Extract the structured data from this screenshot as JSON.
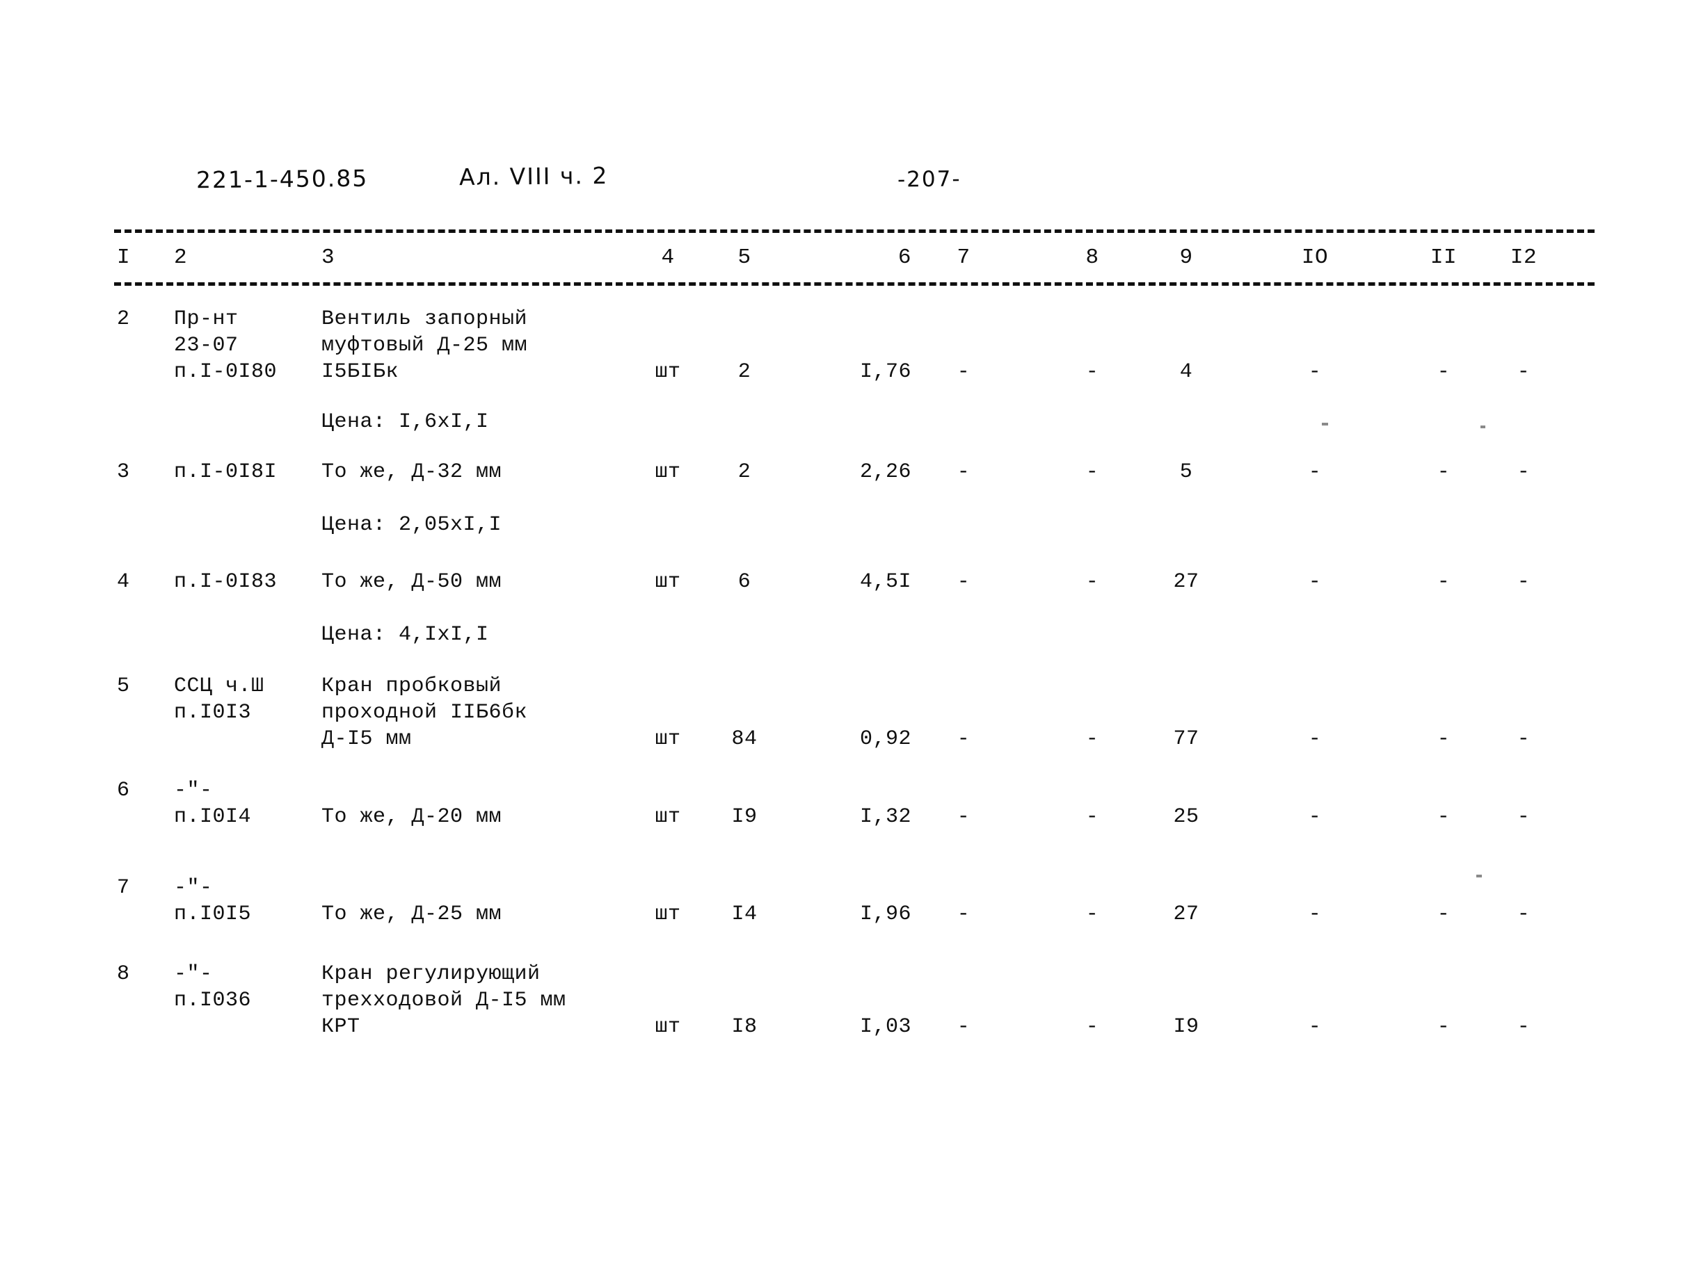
{
  "header": {
    "project_code": "221-1-450.85",
    "album": "Ал. VIII ч. 2",
    "page_number": "-207-"
  },
  "table": {
    "column_headers": [
      "I",
      "2",
      "3",
      "4",
      "5",
      "6",
      "7",
      "8",
      "9",
      "IO",
      "II",
      "I2"
    ],
    "rows": [
      {
        "num": "2",
        "code": "Пр-нт\n23-07\nп.I-0I80",
        "name": "Вентиль запорный\nмуфтовый Д-25 мм\nI5БIБк",
        "price_note": "Цена: I,6xI,I",
        "unit": "шт",
        "qty": "2",
        "c6": "I,76",
        "c7": "-",
        "c8": "-",
        "c9": "4",
        "c10": "-",
        "c11": "-",
        "c12": "-"
      },
      {
        "num": "3",
        "code": "п.I-0I8I",
        "name": "То же, Д-32 мм",
        "price_note": "Цена: 2,05xI,I",
        "unit": "шт",
        "qty": "2",
        "c6": "2,26",
        "c7": "-",
        "c8": "-",
        "c9": "5",
        "c10": "-",
        "c11": "-",
        "c12": "-"
      },
      {
        "num": "4",
        "code": "п.I-0I83",
        "name": "То же, Д-50 мм",
        "price_note": "Цена: 4,IxI,I",
        "unit": "шт",
        "qty": "6",
        "c6": "4,5I",
        "c7": "-",
        "c8": "-",
        "c9": "27",
        "c10": "-",
        "c11": "-",
        "c12": "-"
      },
      {
        "num": "5",
        "code": "ССЦ ч.Ш\nп.I0I3",
        "name": "Кран пробковый\nпроходной IIБ6бк\nД-I5 мм",
        "price_note": "",
        "unit": "шт",
        "qty": "84",
        "c6": "0,92",
        "c7": "-",
        "c8": "-",
        "c9": "77",
        "c10": "-",
        "c11": "-",
        "c12": "-"
      },
      {
        "num": "6",
        "code": "-\"-\nп.I0I4",
        "name": "То же, Д-20 мм",
        "price_note": "",
        "unit": "шт",
        "qty": "I9",
        "c6": "I,32",
        "c7": "-",
        "c8": "-",
        "c9": "25",
        "c10": "-",
        "c11": "-",
        "c12": "-"
      },
      {
        "num": "7",
        "code": "-\"-\nп.I0I5",
        "name": "То же, Д-25 мм",
        "price_note": "",
        "unit": "шт",
        "qty": "I4",
        "c6": "I,96",
        "c7": "-",
        "c8": "-",
        "c9": "27",
        "c10": "-",
        "c11": "-",
        "c12": "-"
      },
      {
        "num": "8",
        "code": "-\"-\nп.I036",
        "name": "Кран регулирующий\nтрехходовой Д-I5 мм\nКРТ",
        "price_note": "",
        "unit": "шт",
        "qty": "I8",
        "c6": "I,03",
        "c7": "-",
        "c8": "-",
        "c9": "I9",
        "c10": "-",
        "c11": "-",
        "c12": "-"
      }
    ]
  }
}
